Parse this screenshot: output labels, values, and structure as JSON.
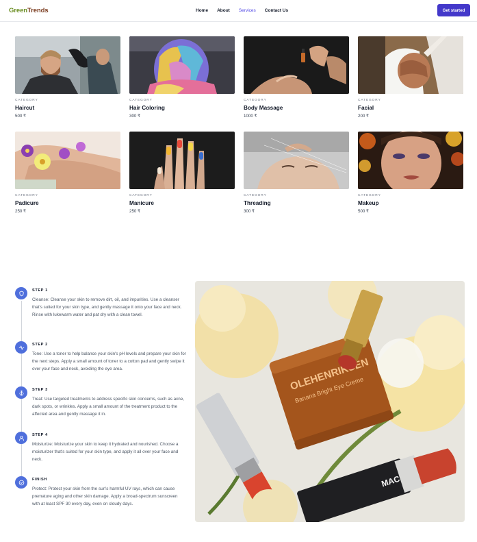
{
  "header": {
    "logo_part1": "Green",
    "logo_part2": "Trends",
    "nav": [
      {
        "label": "Home",
        "active": false
      },
      {
        "label": "About",
        "active": false
      },
      {
        "label": "Services",
        "active": true
      },
      {
        "label": "Contact Us",
        "active": false
      }
    ],
    "cta_label": "Get started"
  },
  "services": [
    {
      "category": "CATEGORY",
      "title": "Haircut",
      "price": "500 ₹"
    },
    {
      "category": "CATEGORY",
      "title": "Hair Coloring",
      "price": "300 ₹"
    },
    {
      "category": "CATEGORY",
      "title": "Body Massage",
      "price": "1000 ₹"
    },
    {
      "category": "CATEGORY",
      "title": "Facial",
      "price": "200 ₹"
    },
    {
      "category": "CATEGORY",
      "title": "Padicure",
      "price": "250 ₹"
    },
    {
      "category": "CATEGORY",
      "title": "Manicure",
      "price": "250 ₹"
    },
    {
      "category": "CATEGORY",
      "title": "Threading",
      "price": "300 ₹"
    },
    {
      "category": "CATEGORY",
      "title": "Makeup",
      "price": "500 ₹"
    }
  ],
  "steps": [
    {
      "heading": "STEP 1",
      "icon": "shield-icon",
      "text": "Cleanse: Cleanse your skin to remove dirt, oil, and impurities. Use a cleanser that's suited for your skin type, and gently massage it onto your face and neck. Rinse with lukewarm water and pat dry with a clean towel."
    },
    {
      "heading": "STEP 2",
      "icon": "pulse-icon",
      "text": "Tone: Use a toner to help balance your skin's pH levels and prepare your skin for the next steps. Apply a small amount of toner to a cotton pad and gently swipe it over your face and neck, avoiding the eye area."
    },
    {
      "heading": "STEP 3",
      "icon": "anchor-icon",
      "text": "Treat: Use targeted treatments to address specific skin concerns, such as acne, dark spots, or wrinkles. Apply a small amount of the treatment product to the affected area and gently massage it in."
    },
    {
      "heading": "STEP 4",
      "icon": "user-icon",
      "text": "Moisturize: Moisturize your skin to keep it hydrated and nourished. Choose a moisturizer that's suited for your skin type, and apply it all over your face and neck."
    },
    {
      "heading": "FINISH",
      "icon": "check-circle-icon",
      "text": "Protect: Protect your skin from the sun's harmful UV rays, which can cause premature aging and other skin damage. Apply a broad-spectrum sunscreen with at least SPF 30 every day, even on cloudy days."
    }
  ],
  "hero": {
    "jar_brand": "OLEHENRIKSEN",
    "jar_product": "Banana Bright Eye Creme",
    "lipstick_brand": "MAC"
  },
  "colors": {
    "accent": "#4338ca",
    "nav_active": "#4f46e5",
    "step_icon_bg": "#4f6fdc",
    "logo_green": "#6b8e23",
    "logo_brown": "#7a3b1e"
  }
}
